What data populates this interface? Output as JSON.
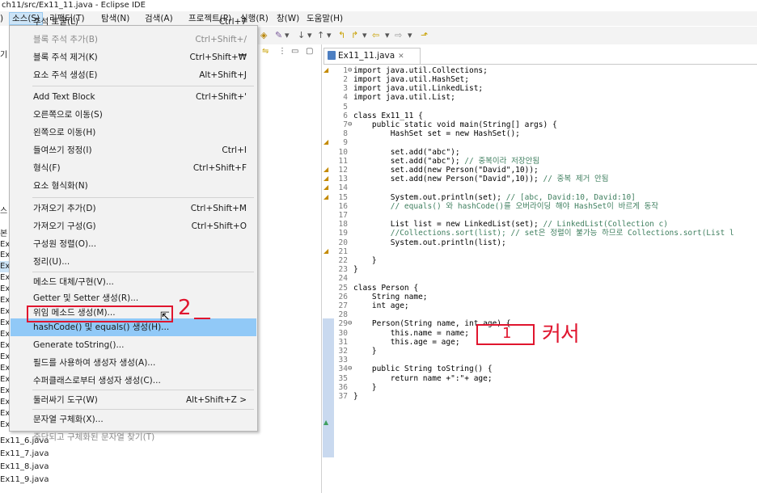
{
  "window": {
    "title": "ch11/src/Ex11_11.java - Eclipse IDE"
  },
  "menubar": [
    "소스(S)",
    "리팩터(T)",
    "탐색(N)",
    "검색(A)",
    "프로젝트(P)",
    "실행(R)",
    "창(W)",
    "도움말(H)"
  ],
  "menu": {
    "items": [
      {
        "label": "주석 토글(L)",
        "shortcut": "Ctrl+7",
        "disabled": false
      },
      {
        "label": "블록 주석 추가(B)",
        "shortcut": "Ctrl+Shift+/",
        "disabled": true
      },
      {
        "label": "블록 주석 제거(K)",
        "shortcut": "Ctrl+Shift+₩",
        "disabled": false
      },
      {
        "label": "요소 주석 생성(E)",
        "shortcut": "Alt+Shift+J",
        "disabled": false
      },
      {
        "label": "Add Text Block",
        "shortcut": "Ctrl+Shift+'",
        "disabled": false
      },
      {
        "label": "오른쪽으로 이동(S)",
        "shortcut": "",
        "disabled": false
      },
      {
        "label": "왼쪽으로 이동(H)",
        "shortcut": "",
        "disabled": false
      },
      {
        "label": "들여쓰기 정정(I)",
        "shortcut": "Ctrl+I",
        "disabled": false
      },
      {
        "label": "형식(F)",
        "shortcut": "Ctrl+Shift+F",
        "disabled": false
      },
      {
        "label": "요소 형식화(N)",
        "shortcut": "",
        "disabled": false
      },
      {
        "label": "가져오기 추가(D)",
        "shortcut": "Ctrl+Shift+M",
        "disabled": false
      },
      {
        "label": "가져오기 구성(G)",
        "shortcut": "Ctrl+Shift+O",
        "disabled": false
      },
      {
        "label": "구성원 정렬(O)...",
        "shortcut": "",
        "disabled": false
      },
      {
        "label": "정리(U)...",
        "shortcut": "",
        "disabled": false
      },
      {
        "label": "메소드 대체/구현(V)...",
        "shortcut": "",
        "disabled": false
      },
      {
        "label": "Getter 및 Setter 생성(R)...",
        "shortcut": "",
        "disabled": false
      },
      {
        "label": "위임 메소드 생성(M)...",
        "shortcut": "",
        "disabled": false
      },
      {
        "label": "hashCode() 및 equals() 생성(H)...",
        "shortcut": "",
        "disabled": false
      },
      {
        "label": "Generate toString()...",
        "shortcut": "",
        "disabled": false
      },
      {
        "label": "필드를 사용하여 생성자 생성(A)...",
        "shortcut": "",
        "disabled": false
      },
      {
        "label": "수퍼클래스로부터 생성자 생성(C)...",
        "shortcut": "",
        "disabled": false
      },
      {
        "label": "둘러싸기 도구(W)",
        "shortcut": "Alt+Shift+Z >",
        "disabled": false
      },
      {
        "label": "문자열 구체화(X)...",
        "shortcut": "",
        "disabled": false
      },
      {
        "label": "중단되고 구체화된 문자열 찾기(T)",
        "shortcut": "",
        "disabled": true
      }
    ]
  },
  "tree": [
    "Ex11_6.java",
    "Ex11_7.java",
    "Ex11_8.java",
    "Ex11_9.java"
  ],
  "tree_fragments": [
    "기",
    "스",
    "본",
    "Ex",
    "Ex",
    "Ex",
    "Ex",
    "Ex",
    "Ex",
    "Ex",
    "Ex",
    "Ex",
    "Ex",
    "Ex",
    "Ex",
    "Ex",
    "Ex",
    "Ex",
    "Ex",
    "Ex"
  ],
  "editor": {
    "tab": "Ex11_11.java",
    "tab_close": "✕",
    "lines": [
      "1",
      "2",
      "3",
      "4",
      "5",
      "6",
      "7",
      "8",
      "9",
      "10",
      "11",
      "12",
      "13",
      "14",
      "15",
      "16",
      "17",
      "18",
      "19",
      "20",
      "21",
      "22",
      "23",
      "24",
      "25",
      "26",
      "27",
      "28",
      "29",
      "30",
      "31",
      "32",
      "33",
      "34",
      "35",
      "36",
      "37"
    ],
    "code": {
      "l1": "import java.util.Collections;",
      "l2": "import java.util.HashSet;",
      "l3": "import java.util.LinkedList;",
      "l4": "import java.util.List;",
      "l6": "class Ex11_11 {",
      "l7": "    public static void main(String[] args) {",
      "l8": "        HashSet set = new HashSet();",
      "l10": "        set.add(\"abc\");",
      "l11a": "        set.add(\"abc\");",
      "l11b": " // 중복이라 저장안됨",
      "l12": "        set.add(new Person(\"David\",10));",
      "l13a": "        set.add(new Person(\"David\",10));",
      "l13b": " // 중복 제거 안됨",
      "l15a": "        System.out.println(set);",
      "l15b": " // [abc, David:10, David:10]",
      "l16": "        // equals() 와 hashCode()를 오버라이딩 해야 HashSet이 바르게 동작",
      "l18a": "        List list = new LinkedList(set);",
      "l18b": " // LinkedList(Collection c)",
      "l19": "        //Collections.sort(list); // set은 정렬이 불가능 하므로 Collections.sort(List l",
      "l20": "        System.out.println(list);",
      "l22": "    }",
      "l23": "}",
      "l25": "class Person {",
      "l26": "    String name;",
      "l27": "    int age;",
      "l29": "    Person(String name, int age) {",
      "l30": "        this.name = name;",
      "l31": "        this.age = age;",
      "l32": "    }",
      "l34": "    public String toString() {",
      "l35": "        return name +\":\"+ age;",
      "l36": "    }",
      "l37": "}"
    }
  },
  "annotations": {
    "a1_num": "1",
    "a1_text": "커서",
    "a2_num": "2"
  }
}
